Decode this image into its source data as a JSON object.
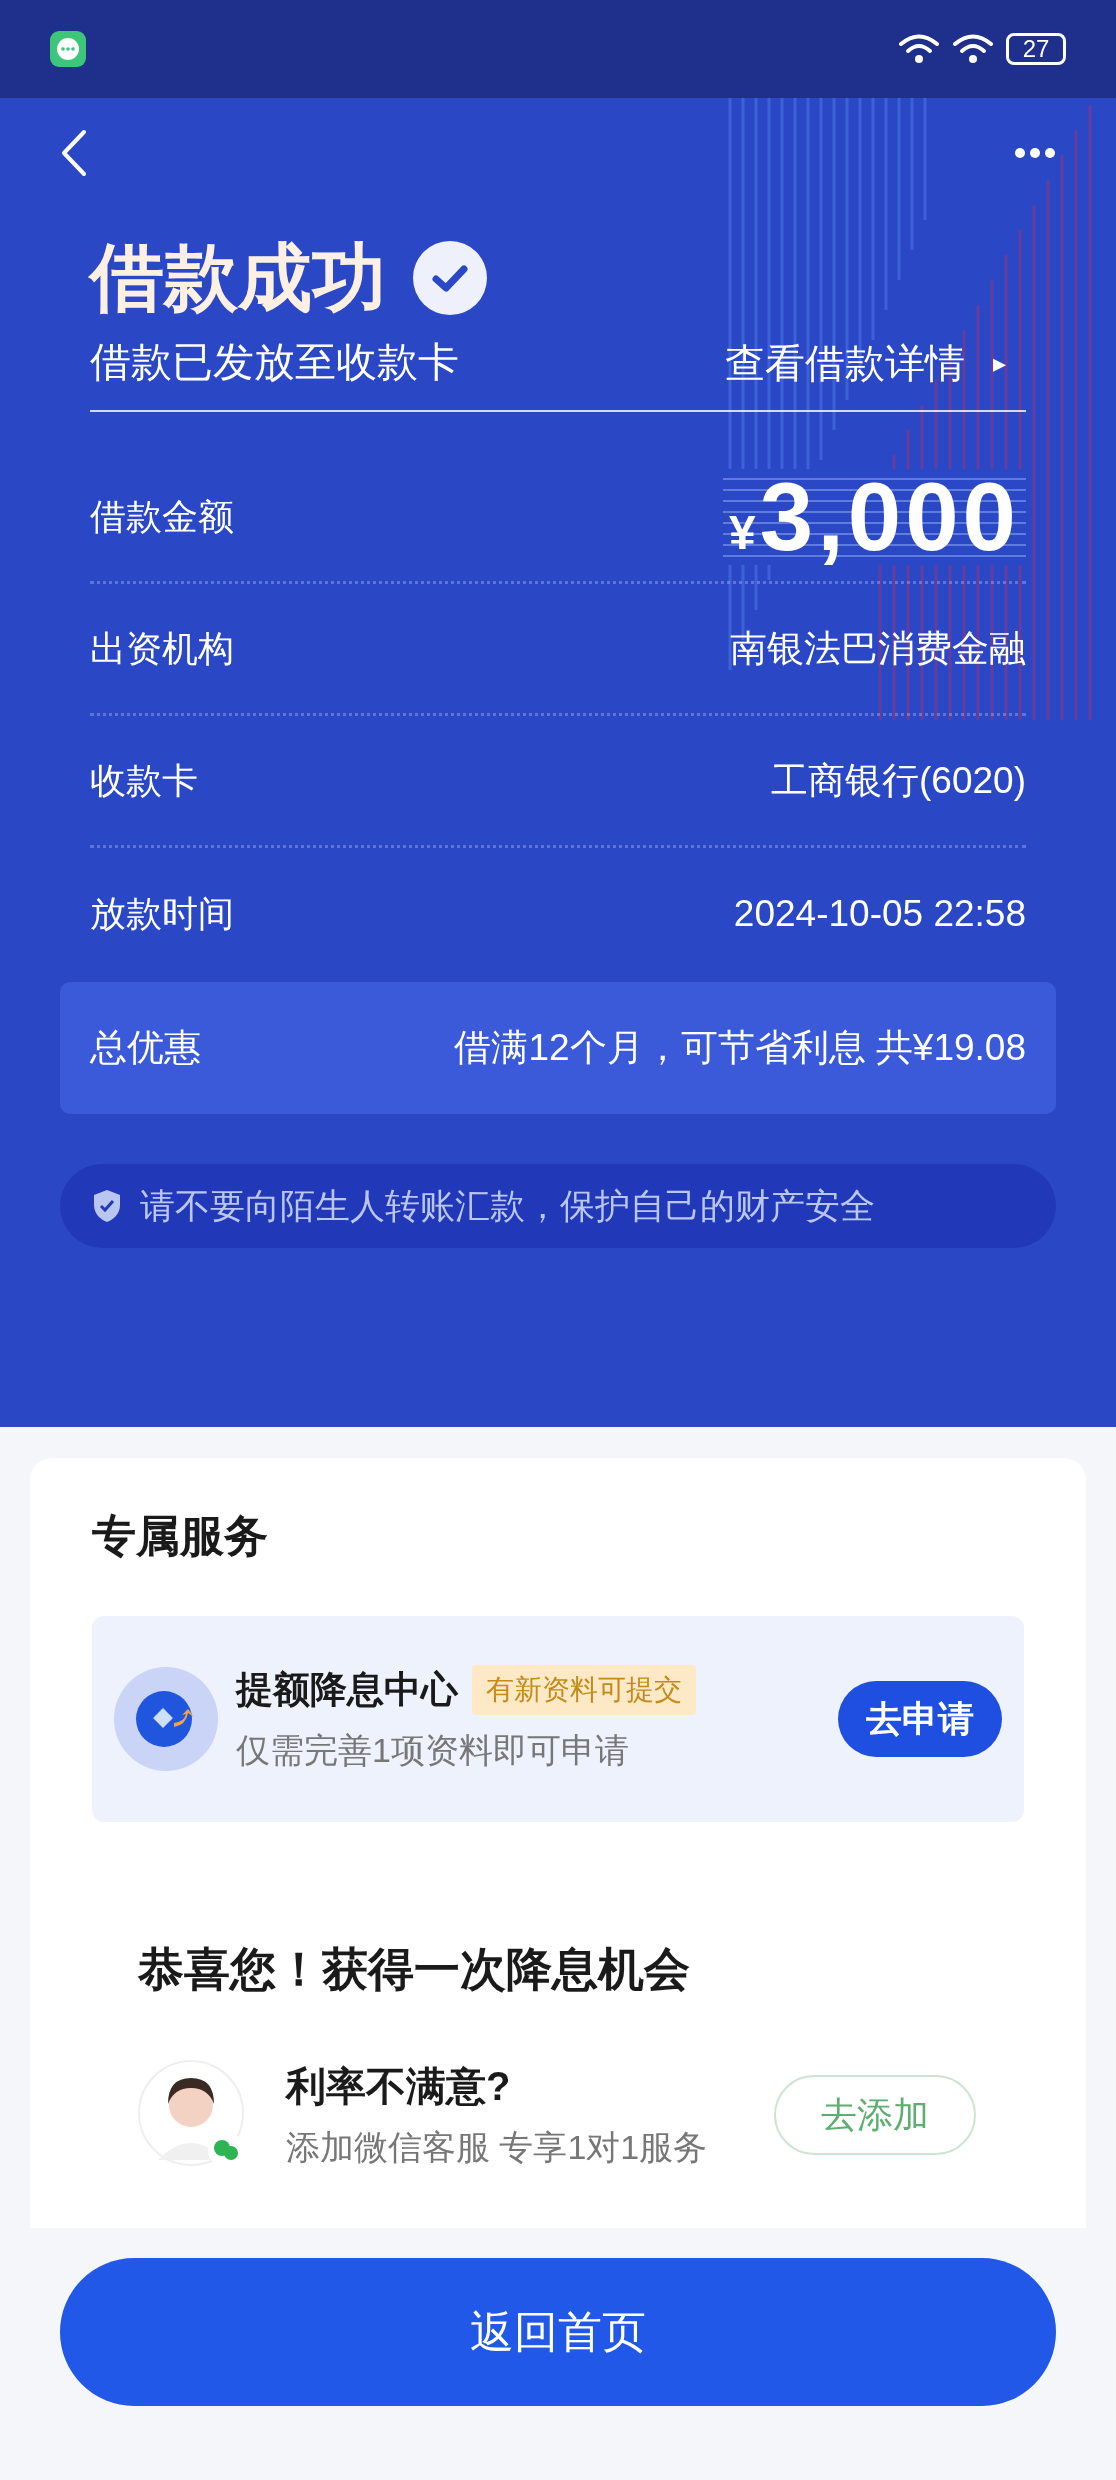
{
  "status_bar": {
    "battery": "27"
  },
  "header": {
    "title": "借款成功",
    "subtitle": "借款已发放至收款卡",
    "details_link": "查看借款详情",
    "details_arrow": "▸"
  },
  "details": [
    {
      "label": "借款金额",
      "kind": "amount",
      "currency": "¥",
      "value": "3,000"
    },
    {
      "label": "出资机构",
      "kind": "text",
      "value": "南银法巴消费金融"
    },
    {
      "label": "收款卡",
      "kind": "text",
      "value": "工商银行(6020)"
    },
    {
      "label": "放款时间",
      "kind": "text",
      "value": "2024-10-05 22:58"
    }
  ],
  "discount": {
    "label": "总优惠",
    "value": "借满12个月，可节省利息 共¥19.08"
  },
  "safety_notice": "请不要向陌生人转账汇款，保护自己的财产安全",
  "services": {
    "title": "专属服务",
    "items": [
      {
        "title": "提额降息中心",
        "tag": "有新资料可提交",
        "subtitle": "仅需完善1项资料即可申请",
        "button": "去申请"
      }
    ]
  },
  "promo": {
    "heading": "恭喜您！获得一次降息机会",
    "title": "利率不满意?",
    "subtitle": "添加微信客服 专享1对1服务",
    "button": "去添加"
  },
  "bottom_button": "返回首页"
}
